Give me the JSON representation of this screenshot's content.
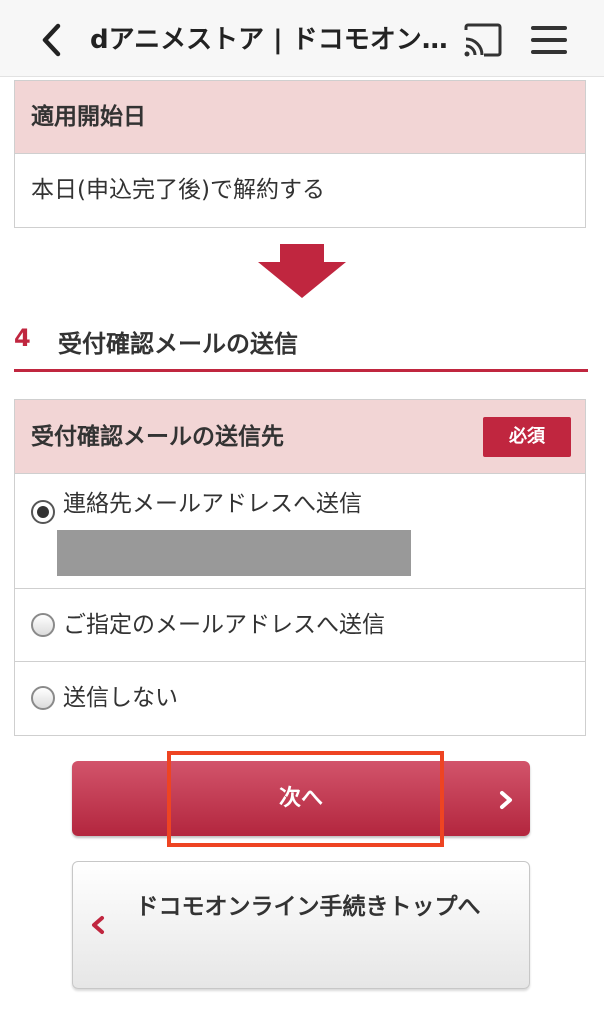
{
  "header": {
    "title": "dアニメストア | ドコモオン…",
    "back_icon": "chevron-left-icon",
    "cast_icon": "cast-icon",
    "menu_icon": "hamburger-menu-icon"
  },
  "start_date": {
    "label": "適用開始日",
    "value": "本日(申込完了後)で解約する"
  },
  "step": {
    "number": "4",
    "title": "受付確認メールの送信"
  },
  "mail": {
    "label": "受付確認メールの送信先",
    "required_badge": "必須",
    "options": [
      {
        "label": "連絡先メールアドレスへ送信",
        "selected": true
      },
      {
        "label": "ご指定のメールアドレスへ送信",
        "selected": false
      },
      {
        "label": "送信しない",
        "selected": false
      }
    ]
  },
  "buttons": {
    "next": "次へ",
    "top": "ドコモオンライン手続きトップへ"
  },
  "colors": {
    "accent": "#c0263f",
    "header_bg": "#f2d5d5",
    "highlight": "#ee4422"
  }
}
